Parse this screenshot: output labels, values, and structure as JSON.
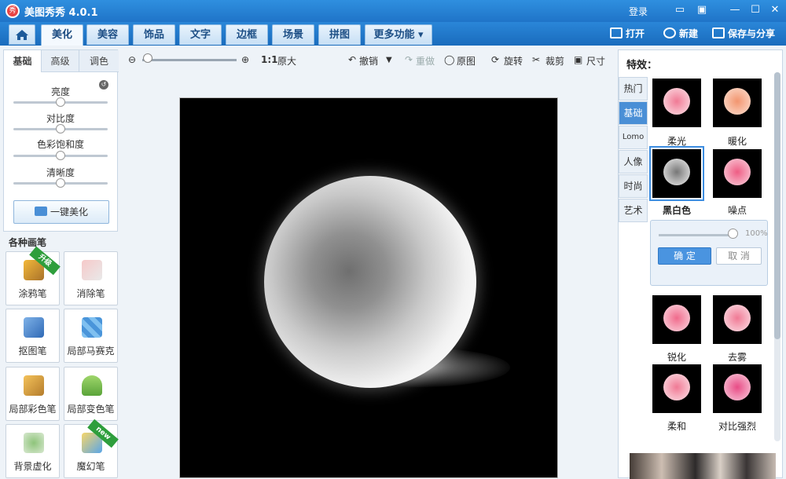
{
  "app": {
    "title": "美图秀秀 4.0.1",
    "logo_char": "秀",
    "login": "登录"
  },
  "main_tabs": [
    "美化",
    "美容",
    "饰品",
    "文字",
    "边框",
    "场景",
    "拼图",
    "更多功能"
  ],
  "top_actions": {
    "open": "打开",
    "new": "新建",
    "save": "保存与分享"
  },
  "left": {
    "subtabs": [
      "基础",
      "高级",
      "调色"
    ],
    "sliders": [
      {
        "label": "亮度",
        "value": 50
      },
      {
        "label": "对比度",
        "value": 50
      },
      {
        "label": "色彩饱和度",
        "value": 50
      },
      {
        "label": "清晰度",
        "value": 50
      }
    ],
    "one_click": "一键美化",
    "brushes_title": "各种画笔",
    "brushes": [
      {
        "label": "涂鸦笔",
        "badge": "升级"
      },
      {
        "label": "消除笔",
        "badge": ""
      },
      {
        "label": "抠图笔",
        "badge": ""
      },
      {
        "label": "局部马赛克",
        "badge": ""
      },
      {
        "label": "局部彩色笔",
        "badge": ""
      },
      {
        "label": "局部变色笔",
        "badge": ""
      },
      {
        "label": "背景虚化",
        "badge": ""
      },
      {
        "label": "魔幻笔",
        "badge": "new"
      }
    ]
  },
  "toolbar": {
    "ratio": "1:1",
    "original_size": "原大",
    "undo": "撤销",
    "redo": "重做",
    "original": "原图",
    "rotate": "旋转",
    "crop": "裁剪",
    "resize": "尺寸"
  },
  "right": {
    "title": "特效：",
    "vtabs": [
      "热门",
      "基础",
      "Lomo",
      "人像",
      "时尚",
      "艺术"
    ],
    "effects": [
      "柔光",
      "暖化",
      "黑白色",
      "噪点",
      "锐化",
      "去雾",
      "柔和",
      "对比强烈"
    ],
    "popup": {
      "percent": "100%",
      "confirm": "确 定",
      "cancel": "取 消",
      "level": 1.0
    }
  },
  "colors": {
    "accent": "#1f74c8",
    "tab_bg": "#c6dff5",
    "selected": "#4a8fd6"
  }
}
